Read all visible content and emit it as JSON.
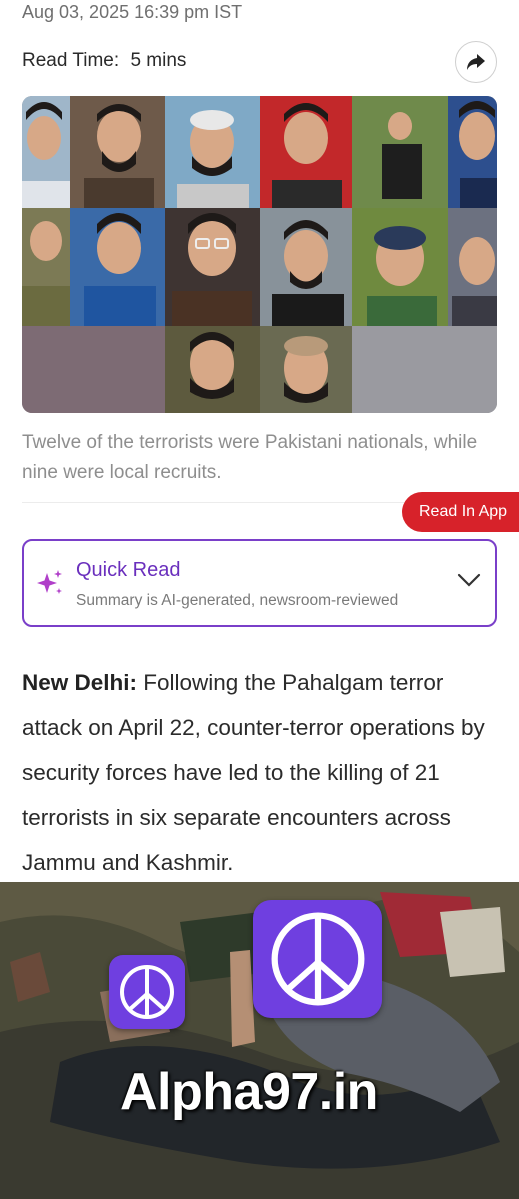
{
  "article": {
    "timestamp": "Aug 03, 2025 16:39 pm IST",
    "read_time_label": "Read Time:",
    "read_time_value": "5 mins",
    "image_caption": "Twelve of the terrorists were Pakistani nationals, while nine were local recruits.",
    "dateline": "New Delhi:",
    "body": " Following the Pahalgam terror attack on April 22, counter-terror operations by security forces have led to the killing of 21 terrorists in six separate encounters across Jammu and Kashmir."
  },
  "read_in_app": {
    "label": "Read In App",
    "color": "#d7222a"
  },
  "quick_read": {
    "title": "Quick Read",
    "subtitle": "Summary is AI-generated, newsroom-reviewed",
    "accent": "#7a3fc9"
  },
  "icons": {
    "share": "share-arrow-icon",
    "sparkle": "sparkle-icon",
    "chevron": "chevron-down-icon",
    "overlay": "peace-sign-icon"
  },
  "watermark": {
    "text": "Alpha97.in"
  }
}
